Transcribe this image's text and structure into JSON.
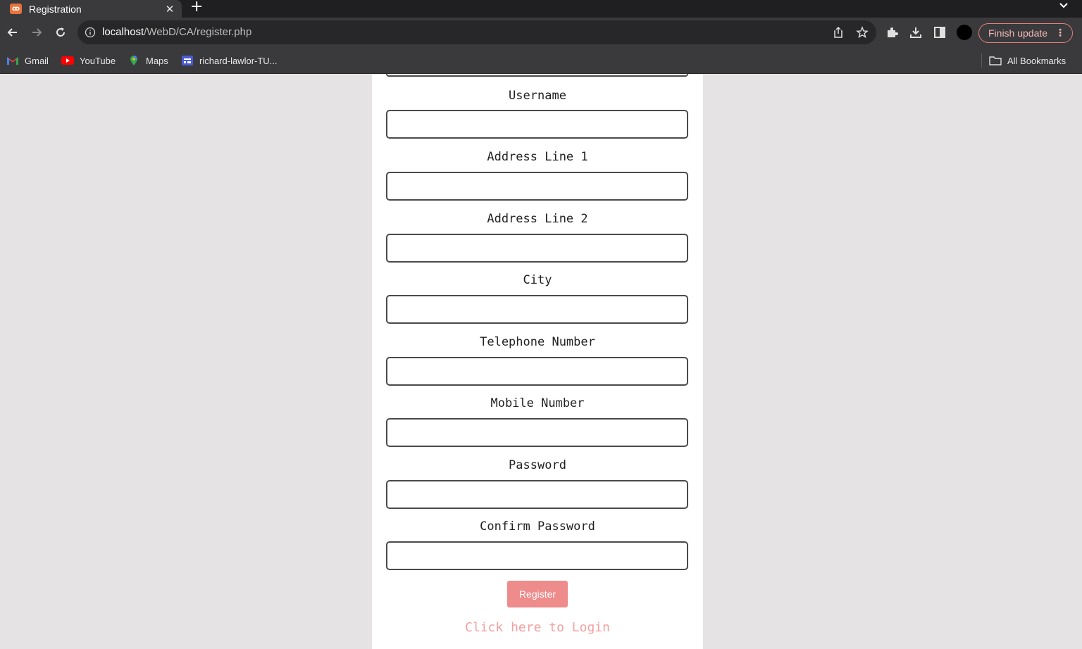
{
  "browser": {
    "tab_title": "Registration",
    "tab_favicon": "xampp-icon",
    "url_host": "localhost",
    "url_path": "/WebD/CA/register.php",
    "finish_update_label": "Finish update",
    "bookmarks": [
      {
        "label": "Gmail",
        "icon": "gmail-icon"
      },
      {
        "label": "YouTube",
        "icon": "youtube-icon"
      },
      {
        "label": "Maps",
        "icon": "maps-icon"
      },
      {
        "label": "richard-lawlor-TU...",
        "icon": "board-icon"
      }
    ],
    "all_bookmarks_label": "All Bookmarks",
    "colors": {
      "accent_update": "#e0817a"
    }
  },
  "form": {
    "fields": [
      {
        "label": "Username",
        "value": ""
      },
      {
        "label": "Address Line 1",
        "value": ""
      },
      {
        "label": "Address Line 2",
        "value": ""
      },
      {
        "label": "City",
        "value": ""
      },
      {
        "label": "Telephone Number",
        "value": ""
      },
      {
        "label": "Mobile Number",
        "value": ""
      },
      {
        "label": "Password",
        "value": ""
      },
      {
        "label": "Confirm Password",
        "value": ""
      }
    ],
    "register_label": "Register",
    "login_link": "Click here to Login",
    "colors": {
      "button": "#ee8b8b",
      "link": "#f2a0a0"
    }
  }
}
